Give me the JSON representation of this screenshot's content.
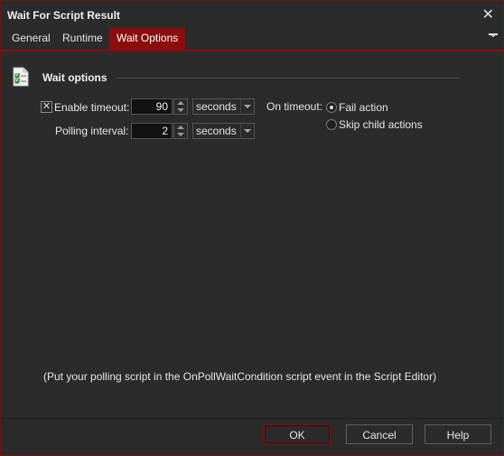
{
  "window": {
    "title": "Wait For Script Result"
  },
  "tabs": [
    {
      "label": "General"
    },
    {
      "label": "Runtime"
    },
    {
      "label": "Wait Options",
      "active": true
    }
  ],
  "section": {
    "title": "Wait options"
  },
  "timeout": {
    "enabled": true,
    "checkbox_mark": "✕",
    "label": "Enable timeout:",
    "value": "90",
    "unit": "seconds"
  },
  "polling": {
    "label": "Polling interval:",
    "value": "2",
    "unit": "seconds"
  },
  "on_timeout": {
    "label": "On timeout:",
    "options": [
      {
        "label": "Fail action",
        "selected": true
      },
      {
        "label": "Skip child actions",
        "selected": false
      }
    ]
  },
  "hint": "(Put your polling script in the OnPollWaitCondition script event in the Script Editor)",
  "buttons": {
    "ok": "OK",
    "cancel": "Cancel",
    "help": "Help"
  },
  "colors": {
    "accent": "#8b0d0d",
    "background": "#2b2b2b",
    "input_bg": "#121212"
  }
}
